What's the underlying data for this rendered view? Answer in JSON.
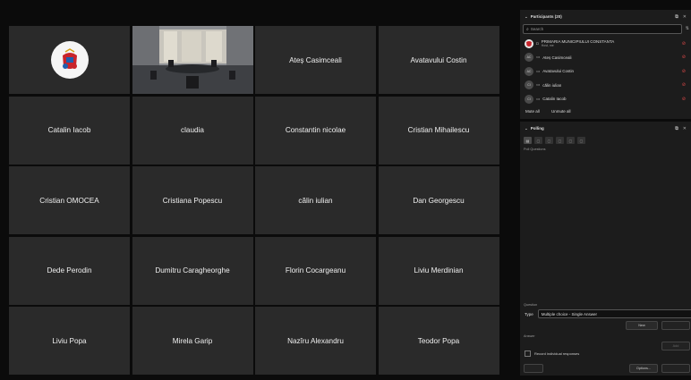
{
  "tiles": [
    {
      "name": "",
      "kind": "logo"
    },
    {
      "name": "",
      "kind": "room"
    },
    {
      "name": "Ateș Casimceali"
    },
    {
      "name": "Avatavului Costin"
    },
    {
      "name": "Catalin Iacob"
    },
    {
      "name": "claudia"
    },
    {
      "name": "Constantin nicolae"
    },
    {
      "name": "Cristian Mihailescu"
    },
    {
      "name": "Cristian OMOCEA"
    },
    {
      "name": "Cristiana Popescu"
    },
    {
      "name": "călin iulian"
    },
    {
      "name": "Dan Georgescu"
    },
    {
      "name": "Dede Perodin"
    },
    {
      "name": "Dumitru Caragheorghe"
    },
    {
      "name": "Florin Cocargeanu"
    },
    {
      "name": "Liviu Merdinian"
    },
    {
      "name": "Liviu Popa"
    },
    {
      "name": "Mirela Garip"
    },
    {
      "name": "Nazîru Alexandru"
    },
    {
      "name": "Teodor Popa"
    }
  ],
  "participants_panel": {
    "title": "Participants (20)",
    "search_placeholder": "Search",
    "participants": [
      {
        "name": "PRIMARIA MUNICIPIULUI CONSTANTA",
        "sub": "Host, me"
      },
      {
        "name": "Ateș Casimceali",
        "initials": "AC"
      },
      {
        "name": "Avatavului Costin",
        "initials": "AC"
      },
      {
        "name": "călin iulian",
        "initials": "CI"
      },
      {
        "name": "Catalin Iacob",
        "initials": "CI"
      }
    ],
    "mute_all": "Mute all",
    "unmute_all": "Unmute all"
  },
  "polling_panel": {
    "title": "Polling",
    "poll_questions_label": "Poll Questions",
    "question_label": "Question",
    "type_label": "Type",
    "type_value": "Multiple choice - Single Answer",
    "new_button": "New",
    "add_answer_button": "Add",
    "answer_label": "Answer",
    "record_label": "Record individual responses",
    "options_button": "Options..."
  },
  "colors": {
    "tile_bg": "#2a2a2a",
    "panel_bg": "#1c1c1c",
    "mute_red": "#e04848"
  }
}
